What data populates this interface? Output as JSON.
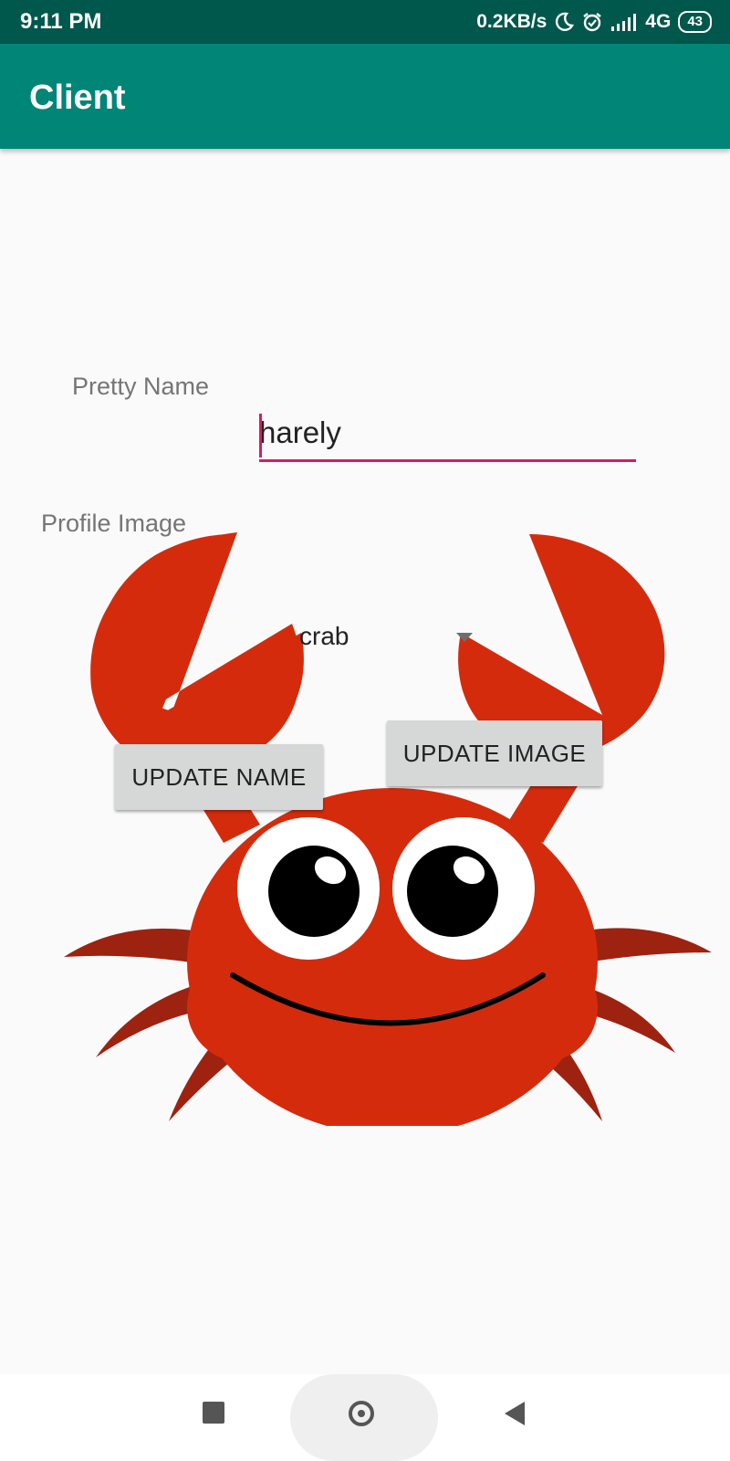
{
  "status_bar": {
    "time": "9:11 PM",
    "network_speed": "0.2KB/s",
    "network_type": "4G",
    "battery": "43",
    "icons": [
      "moon-icon",
      "alarm-icon",
      "signal-icon"
    ]
  },
  "app_bar": {
    "title": "Client"
  },
  "form": {
    "pretty_name_label": "Pretty Name",
    "pretty_name_value": "harely",
    "profile_image_label": "Profile Image",
    "profile_image_selected": "crab",
    "update_name_label": "UPDATE NAME",
    "update_image_label": "UPDATE IMAGE"
  },
  "colors": {
    "status_bar": "#00574b",
    "app_bar": "#008577",
    "accent": "#d81b60",
    "crab_body": "#d52b0d",
    "crab_legs": "#9e2210"
  },
  "nav_bar": {
    "icons": [
      "recents-icon",
      "home-icon",
      "back-icon"
    ]
  }
}
